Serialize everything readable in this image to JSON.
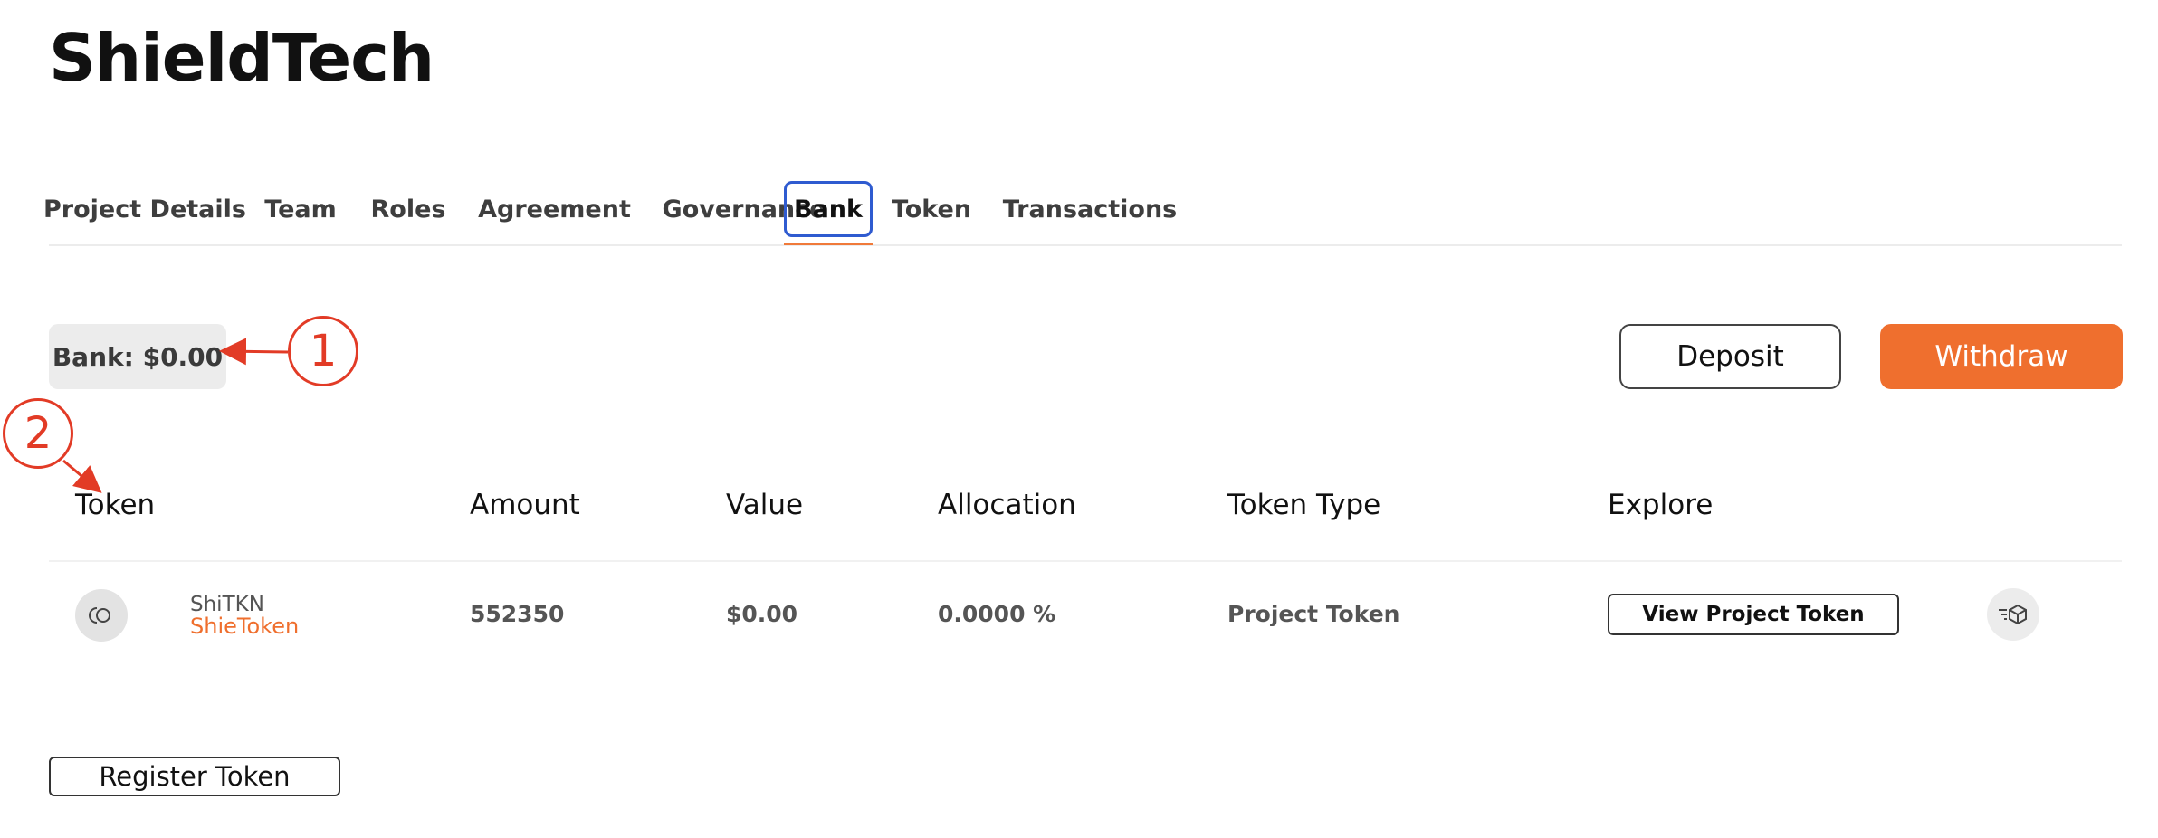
{
  "header": {
    "title": "ShieldTech"
  },
  "tabs": [
    {
      "label": "Project Details"
    },
    {
      "label": "Team"
    },
    {
      "label": "Roles"
    },
    {
      "label": "Agreement"
    },
    {
      "label": "Governance"
    },
    {
      "label": "Bank"
    },
    {
      "label": "Token"
    },
    {
      "label": "Transactions"
    }
  ],
  "active_tab": "Bank",
  "bank": {
    "balance_label": "Bank: $0.00"
  },
  "actions": {
    "deposit_label": "Deposit",
    "withdraw_label": "Withdraw"
  },
  "table": {
    "headers": [
      "Token",
      "Amount",
      "Value",
      "Allocation",
      "Token Type",
      "Explore"
    ],
    "rows": [
      {
        "symbol": "ShiTKN",
        "name": "ShieToken",
        "amount": "552350",
        "value": "$0.00",
        "allocation": "0.0000 %",
        "token_type": "Project Token",
        "explore_label": "View Project Token"
      }
    ]
  },
  "register_label": "Register Token",
  "annotations": [
    "1",
    "2"
  ],
  "colors": {
    "accent": "#ef6f2e",
    "active_tab_border": "#2f5bd0",
    "annotation": "#e23b26"
  }
}
